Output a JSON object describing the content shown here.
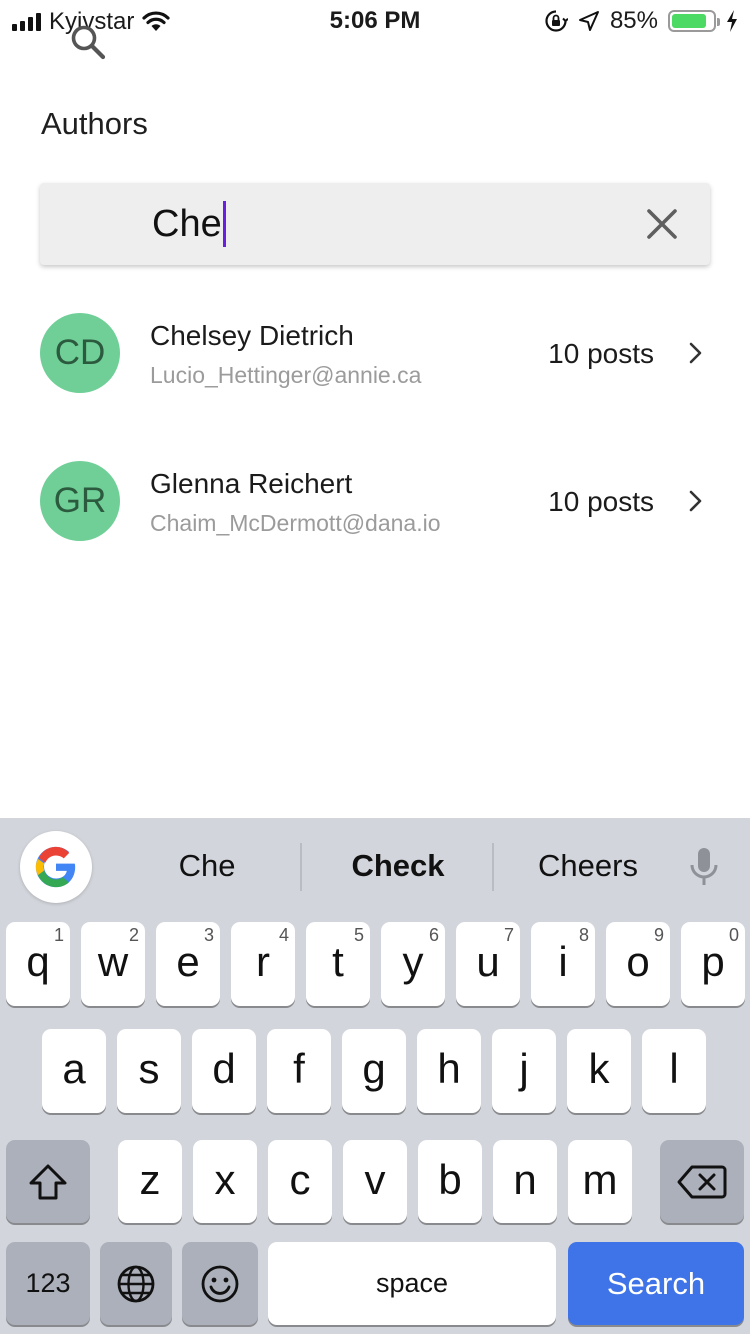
{
  "status_bar": {
    "carrier": "Kyivstar",
    "time": "5:06 PM",
    "battery_percent": "85%",
    "battery_level": 0.85,
    "battery_color": "#4cd964"
  },
  "page": {
    "title": "Authors"
  },
  "search": {
    "value": "Che",
    "caret_color": "#6a1fe0"
  },
  "authors": [
    {
      "initials": "CD",
      "name": "Chelsey Dietrich",
      "email": "Lucio_Hettinger@annie.ca",
      "posts": "10 posts"
    },
    {
      "initials": "GR",
      "name": "Glenna Reichert",
      "email": "Chaim_McDermott@dana.io",
      "posts": "10 posts"
    }
  ],
  "keyboard": {
    "suggestions": [
      "Che",
      "Check",
      "Cheers"
    ],
    "row1": [
      {
        "key": "q",
        "num": "1"
      },
      {
        "key": "w",
        "num": "2"
      },
      {
        "key": "e",
        "num": "3"
      },
      {
        "key": "r",
        "num": "4"
      },
      {
        "key": "t",
        "num": "5"
      },
      {
        "key": "y",
        "num": "6"
      },
      {
        "key": "u",
        "num": "7"
      },
      {
        "key": "i",
        "num": "8"
      },
      {
        "key": "o",
        "num": "9"
      },
      {
        "key": "p",
        "num": "0"
      }
    ],
    "row2": [
      "a",
      "s",
      "d",
      "f",
      "g",
      "h",
      "j",
      "k",
      "l"
    ],
    "row3": [
      "z",
      "x",
      "c",
      "v",
      "b",
      "n",
      "m"
    ],
    "numbers_key": "123",
    "space_key": "space",
    "action_key": "Search",
    "action_color": "#3f73e8",
    "avatar_color": "#6fcf97"
  }
}
